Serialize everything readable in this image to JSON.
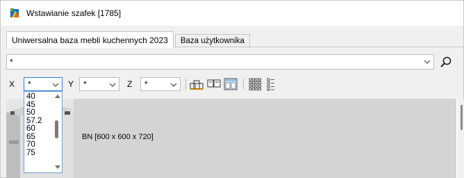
{
  "window": {
    "title": "Wstawianie szafek [1785]",
    "icon": "app-icon"
  },
  "tabs": [
    {
      "label": "Uniwersalna baza mebli kuchennych 2023",
      "active": true
    },
    {
      "label": "Baza użytkownika",
      "active": false
    }
  ],
  "filter": {
    "value": "*",
    "search_icon": "search-icon"
  },
  "dimensions": {
    "x_label": "X",
    "x_value": "*",
    "y_label": "Y",
    "y_value": "*",
    "z_label": "Z",
    "z_value": "*"
  },
  "toolbar": {
    "icons": [
      "insert-cabinet-icon",
      "double-view-icon",
      "layout-view-icon",
      "grid-view-icon",
      "list-view-icon"
    ]
  },
  "x_dropdown": {
    "options": [
      "40",
      "45",
      "50",
      "57.2",
      "60",
      "65",
      "70",
      "75"
    ]
  },
  "items": [
    {
      "label": "BN  [600 x 600 x 720]"
    }
  ],
  "colors": {
    "accent": "#2a7bd8",
    "item_bar": "#d4d4d4",
    "window_bg": "#f0f0f0"
  }
}
